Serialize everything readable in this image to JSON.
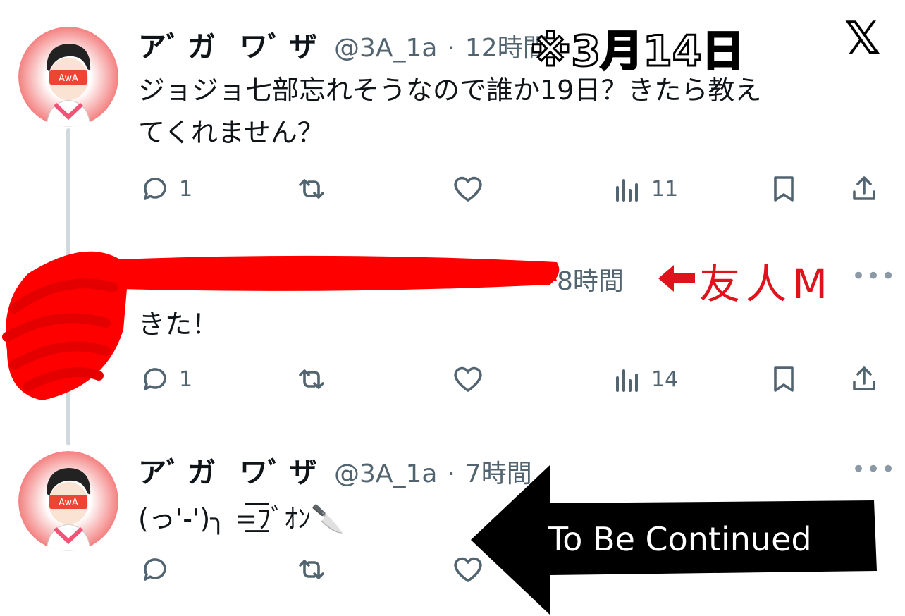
{
  "header": {
    "date_note": "※3月14日",
    "x_logo": "𝕏"
  },
  "tweets": [
    {
      "name": "アﾞガ ワﾞザ",
      "handle": "@3A_1a",
      "sep": "·",
      "time": "12時間",
      "text_line1": "ジョジョ七部忘れそうなので誰か19日？きたら教え",
      "text_line2": "てくれません？",
      "reply_count": "1",
      "views": "11"
    },
    {
      "time": "8時間",
      "annotation": "友人M",
      "text": "きた！",
      "reply_count": "1",
      "views": "14"
    },
    {
      "name": "アﾞガ ワﾞザ",
      "handle": "@3A_1a",
      "sep": "·",
      "time": "7時間",
      "text": "(っ'-')╮ =͟͟͞͞ﾌﾞｵﾝ🔪"
    }
  ],
  "overlay": {
    "arrow_text": "To Be Continued"
  },
  "icons": {
    "reply": "reply-icon",
    "retweet": "retweet-icon",
    "like": "heart-icon",
    "views": "views-icon",
    "bookmark": "bookmark-icon",
    "share": "share-icon",
    "more": "more-icon"
  },
  "colors": {
    "redact": "#ff0000",
    "annotation": "#e0121b",
    "muted": "#536471",
    "line": "#cfd9de"
  }
}
